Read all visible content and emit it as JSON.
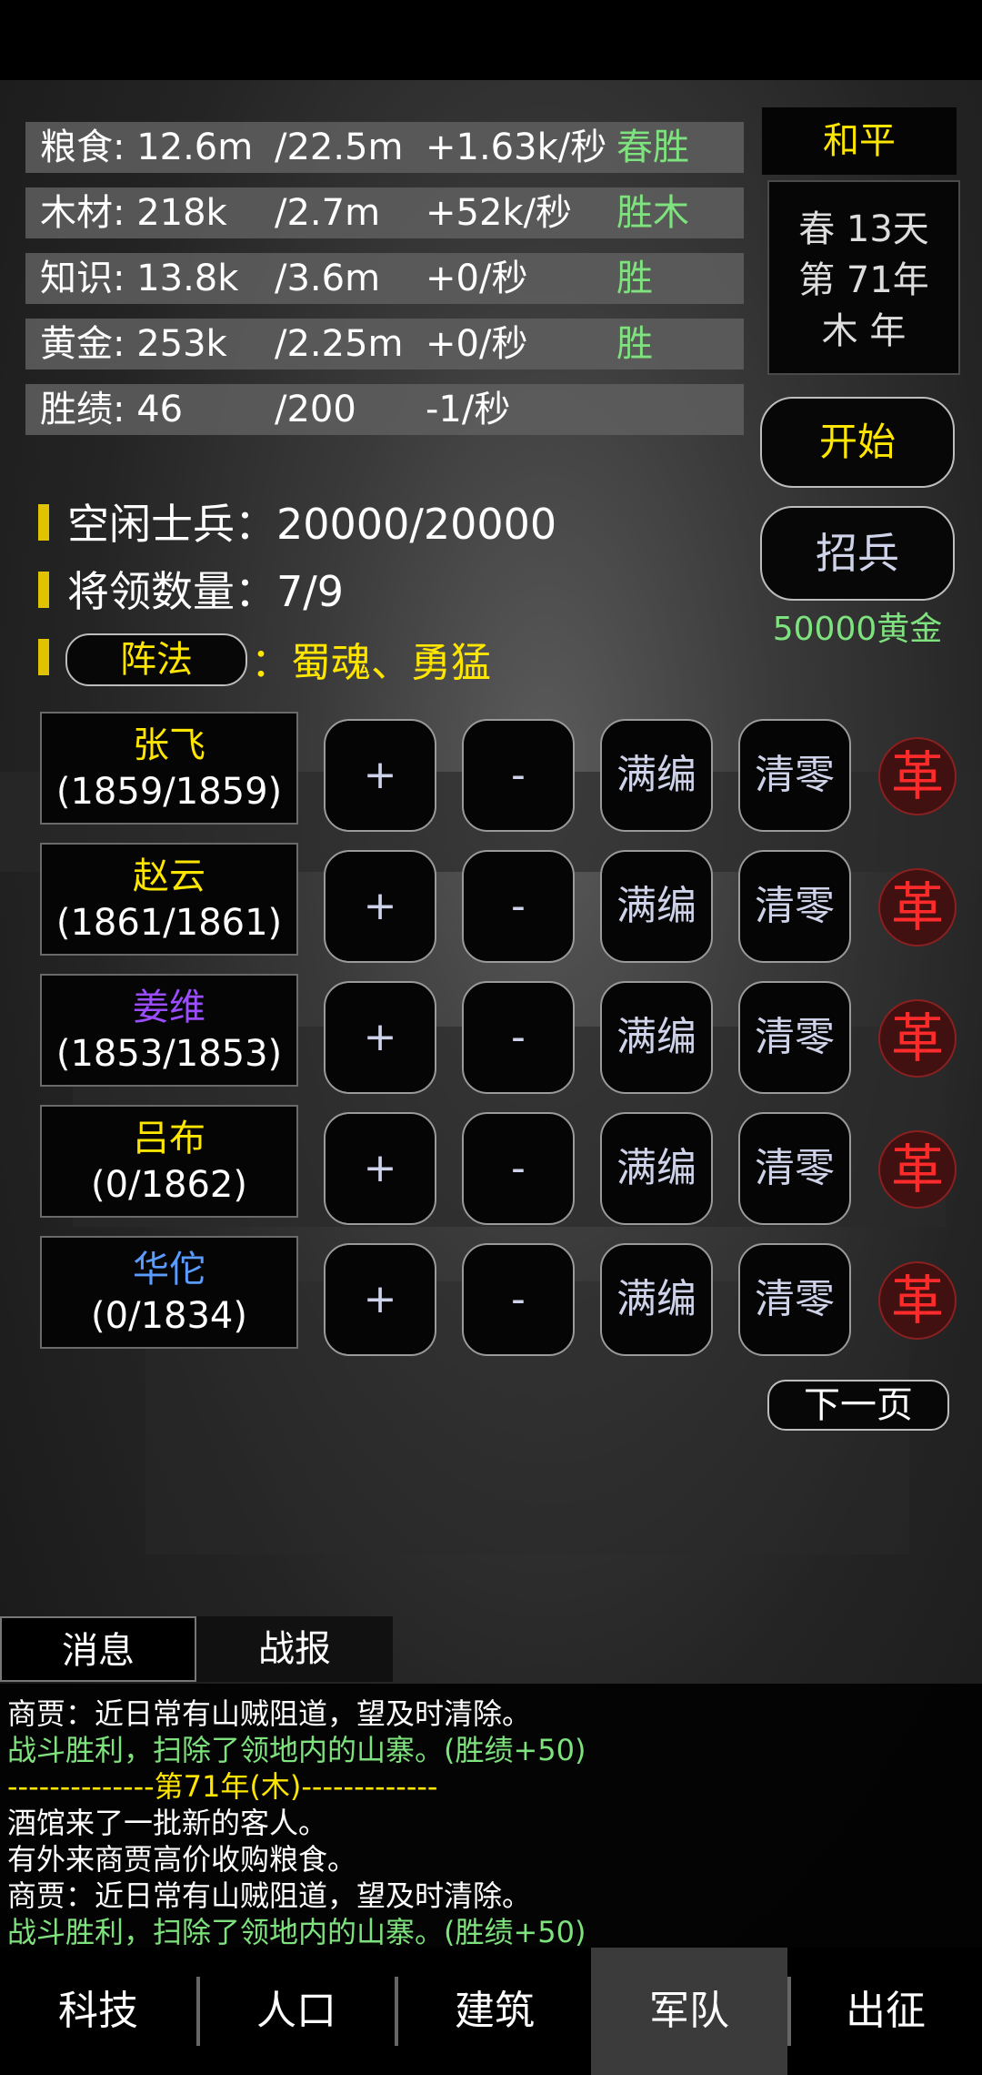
{
  "resources": [
    {
      "name": "粮食: 12.6m",
      "cap": "/22.5m",
      "rate": "+1.63k/秒",
      "extra": "春胜"
    },
    {
      "name": "木材: 218k",
      "cap": "/2.7m",
      "rate": "+52k/秒",
      "extra": "胜木"
    },
    {
      "name": "知识: 13.8k",
      "cap": "/3.6m",
      "rate": "+0/秒",
      "extra": "胜"
    },
    {
      "name": "黄金: 253k",
      "cap": "/2.25m",
      "rate": "+0/秒",
      "extra": "胜"
    },
    {
      "name": "胜绩: 46",
      "cap": "/200",
      "rate": "-1/秒",
      "extra": ""
    }
  ],
  "status": {
    "peace": "和平",
    "season_day": "春 13天",
    "year": "第 71年",
    "element_year": "木 年"
  },
  "buttons": {
    "start": "开始",
    "recruit": "招兵",
    "recruit_cost": "50000黄金",
    "next_page": "下一页",
    "formation": "阵法"
  },
  "info": {
    "idle_soldiers": "空闲士兵：20000/20000",
    "general_count": "将领数量：7/9",
    "formation_value": "：蜀魂、勇猛"
  },
  "generals": [
    {
      "name": "张飞",
      "count": "(1859/1859)",
      "color": "#ffe600"
    },
    {
      "name": "赵云",
      "count": "(1861/1861)",
      "color": "#ffe600"
    },
    {
      "name": "姜维",
      "count": "(1853/1853)",
      "color": "#9b4dff"
    },
    {
      "name": "吕布",
      "count": "(0/1862)",
      "color": "#ffe600"
    },
    {
      "name": "华佗",
      "count": "(0/1834)",
      "color": "#5a9cff"
    }
  ],
  "row_actions": {
    "plus": "+",
    "minus": "-",
    "fill": "满编",
    "clear": "清零",
    "ge": "革"
  },
  "tabs": {
    "messages": "消息",
    "battle": "战报"
  },
  "log": [
    {
      "text": "商贾：近日常有山贼阻道，望及时清除。",
      "color": "#ffffff"
    },
    {
      "text": "战斗胜利，扫除了领地内的山寨。(胜绩+50)",
      "color": "#7ee27e"
    },
    {
      "text": "--------------第71年(木)-------------",
      "color": "#ffe600"
    },
    {
      "text": "酒馆来了一批新的客人。",
      "color": "#ffffff"
    },
    {
      "text": "有外来商贾高价收购粮食。",
      "color": "#ffffff"
    },
    {
      "text": "商贾：近日常有山贼阻道，望及时清除。",
      "color": "#ffffff"
    },
    {
      "text": "战斗胜利，扫除了领地内的山寨。(胜绩+50)",
      "color": "#7ee27e"
    }
  ],
  "nav": [
    "科技",
    "人口",
    "建筑",
    "军队",
    "出征"
  ],
  "nav_active": 3
}
